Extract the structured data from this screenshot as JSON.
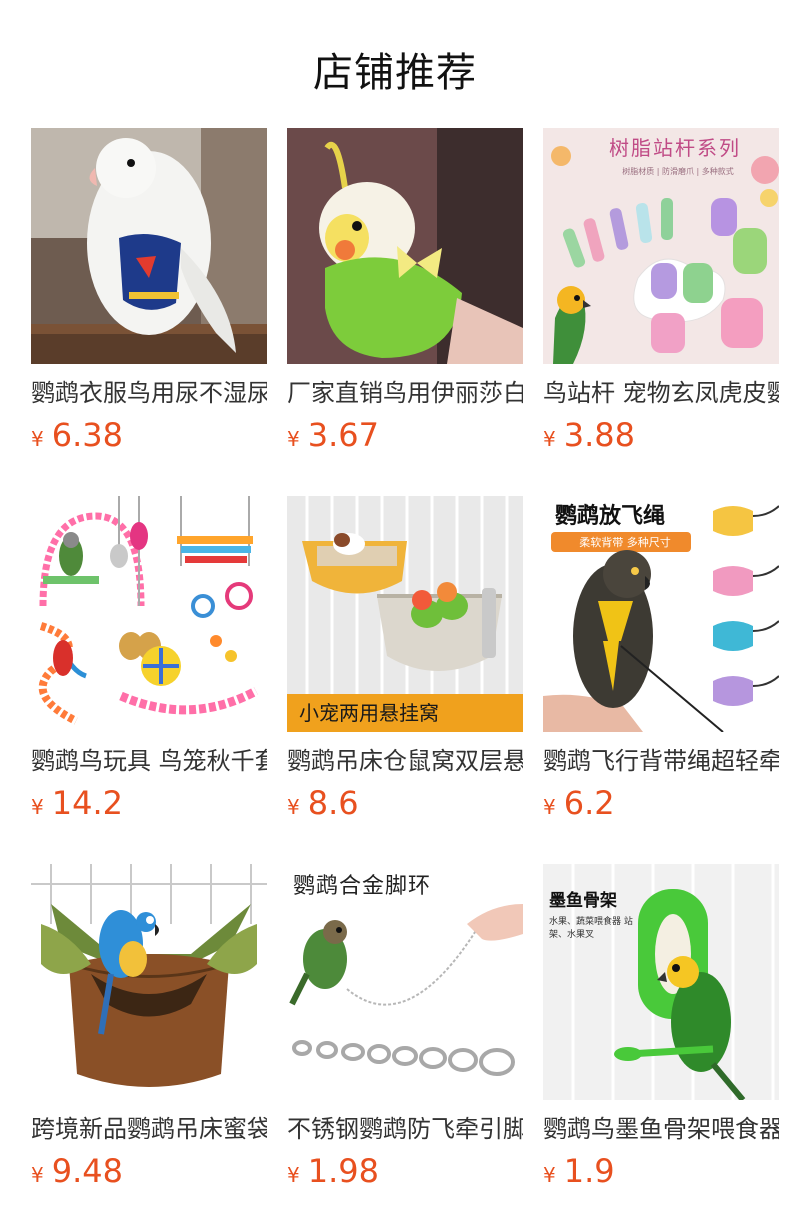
{
  "header": {
    "title": "店铺推荐"
  },
  "products": [
    {
      "title": "鹦鹉衣服鸟用尿不湿尿布",
      "currency": "¥",
      "price": "6.38",
      "image_icon": "parrot-diaper-photo"
    },
    {
      "title": "厂家直销鸟用伊丽莎白圈",
      "currency": "¥",
      "price": "3.67",
      "image_icon": "cockatiel-green-collar-photo"
    },
    {
      "title": "鸟站杆 宠物玄凤虎皮鹦鹉",
      "currency": "¥",
      "price": "3.88",
      "image_icon": "resin-perch-photo",
      "image_text": "树脂站杆系列",
      "image_subtext": "树脂材质 | 防滑磨爪 | 多种款式"
    },
    {
      "title": "鹦鹉鸟玩具 鸟笼秋千套装",
      "currency": "¥",
      "price": "14.2",
      "image_icon": "bird-toys-photo"
    },
    {
      "title": "鹦鹉吊床仓鼠窝双层悬挂",
      "currency": "¥",
      "price": "8.6",
      "image_icon": "hanging-nest-photo",
      "image_text": "小宠两用悬挂窝"
    },
    {
      "title": "鹦鹉飞行背带绳超轻牵引",
      "currency": "¥",
      "price": "6.2",
      "image_icon": "flight-harness-photo",
      "image_text": "鹦鹉放飞绳",
      "image_subtext": "柔软背带  多种尺寸"
    },
    {
      "title": "跨境新品鹦鹉吊床蜜袋鼯",
      "currency": "¥",
      "price": "9.48",
      "image_icon": "parrot-hammock-photo"
    },
    {
      "title": "不锈钢鹦鹉防飞牵引脚环",
      "currency": "¥",
      "price": "1.98",
      "image_icon": "leg-ring-photo",
      "image_text": "鹦鹉合金脚环"
    },
    {
      "title": "鹦鹉鸟墨鱼骨架喂食器",
      "currency": "¥",
      "price": "1.9",
      "image_icon": "cuttlebone-holder-photo",
      "image_text": "墨鱼骨架",
      "image_subtext": "水果、蔬菜喂食器 站架、水果叉"
    }
  ]
}
